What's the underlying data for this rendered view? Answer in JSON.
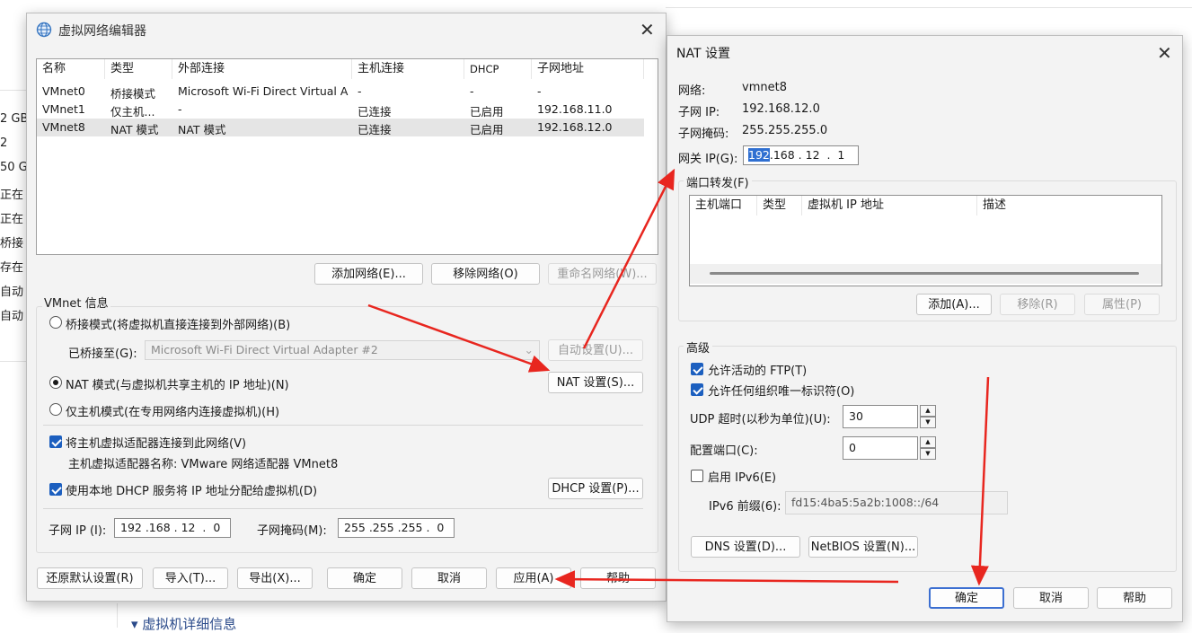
{
  "background": {
    "fragments": [
      "2 GB",
      "2",
      "50 G",
      "正在",
      "正在",
      "桥接",
      "存在",
      "自动",
      "自动"
    ],
    "bottom_section": "▾ 虚拟机详细信息"
  },
  "editor": {
    "title": "虚拟网络编辑器",
    "columns": [
      "名称",
      "类型",
      "外部连接",
      "主机连接",
      "DHCP",
      "子网地址"
    ],
    "rows": [
      [
        "VMnet0",
        "桥接模式",
        "Microsoft Wi-Fi Direct Virtual A...",
        "-",
        "-",
        "-"
      ],
      [
        "VMnet1",
        "仅主机...",
        "-",
        "已连接",
        "已启用",
        "192.168.11.0"
      ],
      [
        "VMnet8",
        "NAT 模式",
        "NAT 模式",
        "已连接",
        "已启用",
        "192.168.12.0"
      ]
    ],
    "buttons": {
      "add_network": "添加网络(E)...",
      "remove_network": "移除网络(O)",
      "rename_network": "重命名网络(W)..."
    },
    "vmnet_info": "VMnet 信息",
    "bridged_label": "桥接模式(将虚拟机直接连接到外部网络)(B)",
    "bridged_to_label": "已桥接至(G):",
    "bridged_adapter": "Microsoft Wi-Fi Direct Virtual Adapter #2",
    "auto_settings": "自动设置(U)...",
    "nat_label": "NAT 模式(与虚拟机共享主机的 IP 地址)(N)",
    "nat_settings": "NAT 设置(S)...",
    "hostonly_label": "仅主机模式(在专用网络内连接虚拟机)(H)",
    "connect_adapter_label": "将主机虚拟适配器连接到此网络(V)",
    "adapter_name": "主机虚拟适配器名称: VMware 网络适配器 VMnet8",
    "dhcp_label": "使用本地 DHCP 服务将 IP 地址分配给虚拟机(D)",
    "dhcp_settings": "DHCP 设置(P)...",
    "subnet_ip_label": "子网 IP (I):",
    "subnet_ip": "192 .168 . 12  .  0",
    "subnet_mask_label": "子网掩码(M):",
    "subnet_mask": "255 .255 .255 .  0",
    "footer": {
      "restore": "还原默认设置(R)",
      "import": "导入(T)...",
      "export": "导出(X)...",
      "ok": "确定",
      "cancel": "取消",
      "apply": "应用(A)",
      "help": "帮助"
    }
  },
  "nat": {
    "title": "NAT 设置",
    "network_label": "网络:",
    "network_value": "vmnet8",
    "subnet_ip_label": "子网 IP:",
    "subnet_ip_value": "192.168.12.0",
    "subnet_mask_label": "子网掩码:",
    "subnet_mask_value": "255.255.255.0",
    "gateway_label": "网关 IP(G):",
    "gateway_first": "192",
    "gateway_rest": ".168 . 12  .  1",
    "port_forwarding": "端口转发(F)",
    "pf_columns": [
      "主机端口",
      "类型",
      "虚拟机 IP 地址",
      "描述"
    ],
    "pf_buttons": {
      "add": "添加(A)...",
      "remove": "移除(R)",
      "properties": "属性(P)"
    },
    "advanced": "高级",
    "allow_ftp": "允许活动的 FTP(T)",
    "allow_oui": "允许任何组织唯一标识符(O)",
    "udp_timeout_label": "UDP 超时(以秒为单位)(U):",
    "udp_timeout": "30",
    "config_port_label": "配置端口(C):",
    "config_port": "0",
    "enable_ipv6": "启用 IPv6(E)",
    "ipv6_prefix_label": "IPv6 前缀(6):",
    "ipv6_prefix": "fd15:4ba5:5a2b:1008::/64",
    "dns_settings": "DNS 设置(D)...",
    "netbios_settings": "NetBIOS 设置(N)...",
    "footer": {
      "ok": "确定",
      "cancel": "取消",
      "help": "帮助"
    }
  },
  "colors": {
    "annotation_arrow": "#e8261f",
    "accent": "#1c5fbf"
  }
}
